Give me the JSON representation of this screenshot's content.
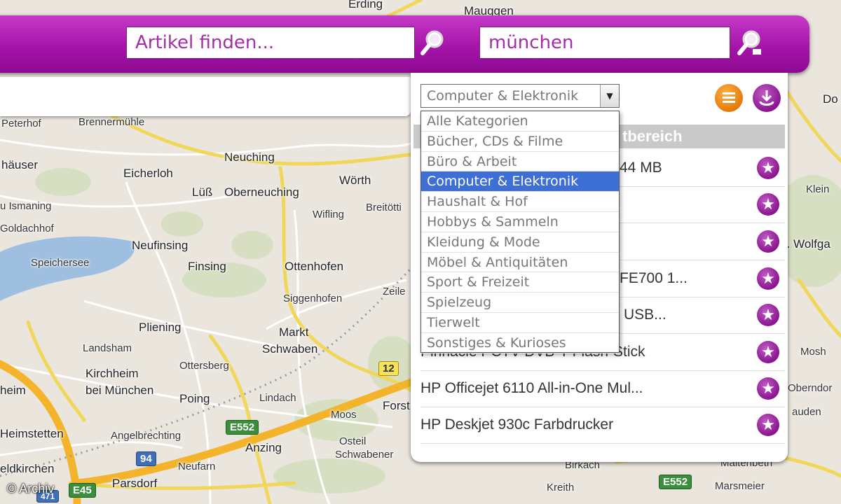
{
  "search": {
    "query_placeholder": "Artikel finden...",
    "location_value": "münchen"
  },
  "category_select": {
    "selected": "Computer & Elektronik",
    "options": [
      "Alle Kategorien",
      "Bücher, CDs & Filme",
      "Büro & Arbeit",
      "Computer & Elektronik",
      "Haushalt & Hof",
      "Hobbys & Sammeln",
      "Kleidung & Mode",
      "Möbel & Antiquitäten",
      "Sport & Freizeit",
      "Spielzeug",
      "Tierwelt",
      "Sonstiges & Kurioses"
    ]
  },
  "results": {
    "header_fragment": "tbereich",
    "items": [
      {
        "text": "44 MB"
      },
      {
        "text": ""
      },
      {
        "text": ""
      },
      {
        "text": "FE700 1..."
      },
      {
        "text": "USB..."
      },
      {
        "text": "Pinnacle PCTV DVB-T Flash-Stick"
      },
      {
        "text": "HP Officejet 6110 All-in-One Mul..."
      },
      {
        "text": "HP Deskjet 930c Farbdrucker"
      }
    ]
  },
  "map": {
    "labels": [
      "Erding",
      "Mauggen",
      "Peterhof",
      "Brennermühle",
      "häuser",
      "Neuching",
      "Eicherloh",
      "Lüß",
      "Oberneuching",
      "Wörth",
      "u Ismaning",
      "Breitötti",
      "Goldachhof",
      "Wifling",
      "Neufinsing",
      "Speichersee",
      "Finsing",
      "Ottenhofen",
      "Zeile",
      "Siggenhofen",
      "Pliening",
      "Markt",
      "Schwaben",
      "Landsham",
      "Kirchheim",
      "bei München",
      "Ottersberg",
      "heim",
      "Poing",
      "Lindach",
      "Forst",
      "Heimstetten",
      "Angelbrechting",
      "Moos",
      "Osteil",
      "Schwabener",
      "Anzing",
      "Neufarn",
      "Parsdorf",
      "eldkirchen",
      "Birkach",
      "Kreith",
      "Marsmeier",
      "Maltenbeth",
      "Do",
      "Klein",
      "t. Wolfga",
      "Mosh",
      "Oberndor",
      "auden"
    ],
    "shields": [
      "12",
      "E552",
      "94",
      "E45",
      "471",
      "E552"
    ]
  },
  "copyright": "© Archiv",
  "colors": {
    "brand": "#a414a8",
    "selection": "#3d6fd6",
    "orange_button": "#f0891a"
  }
}
